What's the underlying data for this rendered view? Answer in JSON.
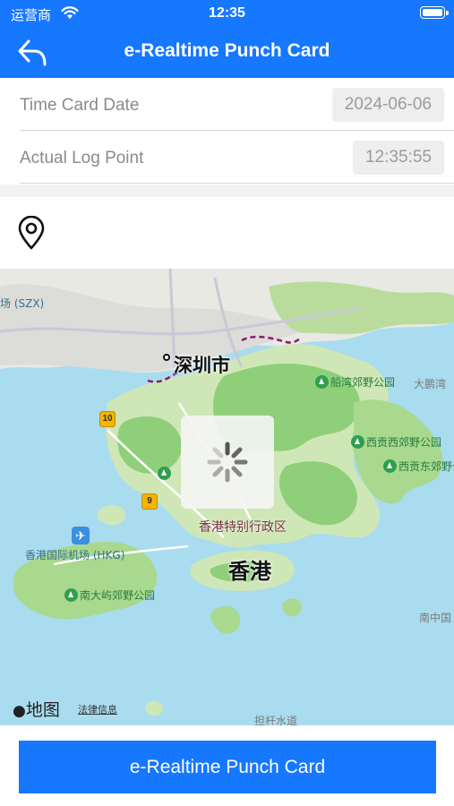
{
  "status_bar": {
    "carrier": "运营商",
    "time": "12:35"
  },
  "nav": {
    "title": "e-Realtime Punch Card",
    "back_icon": "back-arrow-icon"
  },
  "form": {
    "time_card_date_label": "Time Card Date",
    "time_card_date_value": "2024-06-06",
    "actual_log_point_label": "Actual Log Point",
    "actual_log_point_value": "12:35:55"
  },
  "location": {
    "icon": "location-pin-icon"
  },
  "map": {
    "labels": {
      "airport_szx": "场 (SZX)",
      "shenzhen": "深圳市",
      "chuanwan_park": "船湾郊野公园",
      "dapeng": "大鹏湾",
      "xigong_west": "西贡西郊野公园",
      "xigong_east": "西贡东郊野公园",
      "hk_sar": "香港特别行政区",
      "hk_airport": "香港国际机场 (HKG)",
      "hong_kong": "香港",
      "lantau_south_park": "南大屿郊野公园",
      "south_china_sea": "南中国",
      "ganzhou_waterway": "担杆水道",
      "brand": "地图",
      "legal": "法律信息"
    },
    "route_badges": [
      "10",
      "9"
    ],
    "loading": true
  },
  "action": {
    "punch_button_label": "e-Realtime Punch Card"
  },
  "colors": {
    "primary": "#1677ff",
    "water": "#a9dcee",
    "land": "#eef0e6",
    "park": "#8fcf7a"
  }
}
